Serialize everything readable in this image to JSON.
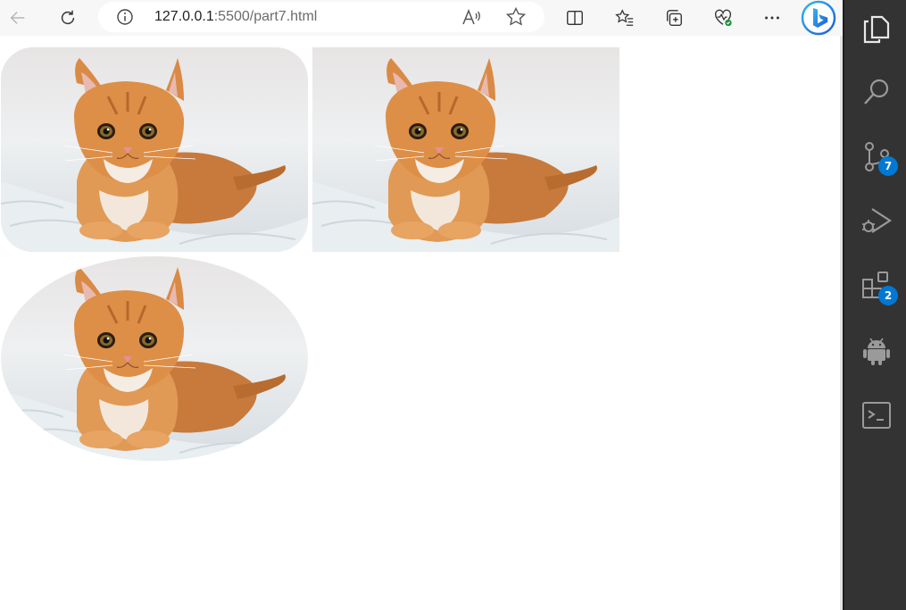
{
  "browser": {
    "url_host": "127.0.0.1",
    "url_rest": ":5500/part7.html",
    "toolbar_icons": [
      "back-icon",
      "refresh-icon",
      "split-screen-icon",
      "favorites-icon",
      "collections-icon",
      "browser-essentials-icon",
      "more-icon",
      "bing-icon"
    ]
  },
  "page": {
    "images": [
      {
        "name": "cat-image-rounded",
        "shape": "rounded-corners"
      },
      {
        "name": "cat-image-square",
        "shape": "square"
      },
      {
        "name": "cat-image-ellipse",
        "shape": "ellipse"
      }
    ]
  },
  "sidebar": {
    "items": [
      {
        "icon": "explorer-icon",
        "badge": ""
      },
      {
        "icon": "search-icon",
        "badge": ""
      },
      {
        "icon": "source-control-icon",
        "badge": "7"
      },
      {
        "icon": "run-debug-icon",
        "badge": ""
      },
      {
        "icon": "extensions-icon",
        "badge": "2"
      },
      {
        "icon": "android-icon",
        "badge": ""
      },
      {
        "icon": "terminal-icon",
        "badge": ""
      }
    ],
    "badge_color": "#0078d4",
    "background": "#333333"
  },
  "colors": {
    "toolbar_bg": "#f7f7f7",
    "address_bg": "#ffffff",
    "cat_fur": "#d98a45"
  }
}
